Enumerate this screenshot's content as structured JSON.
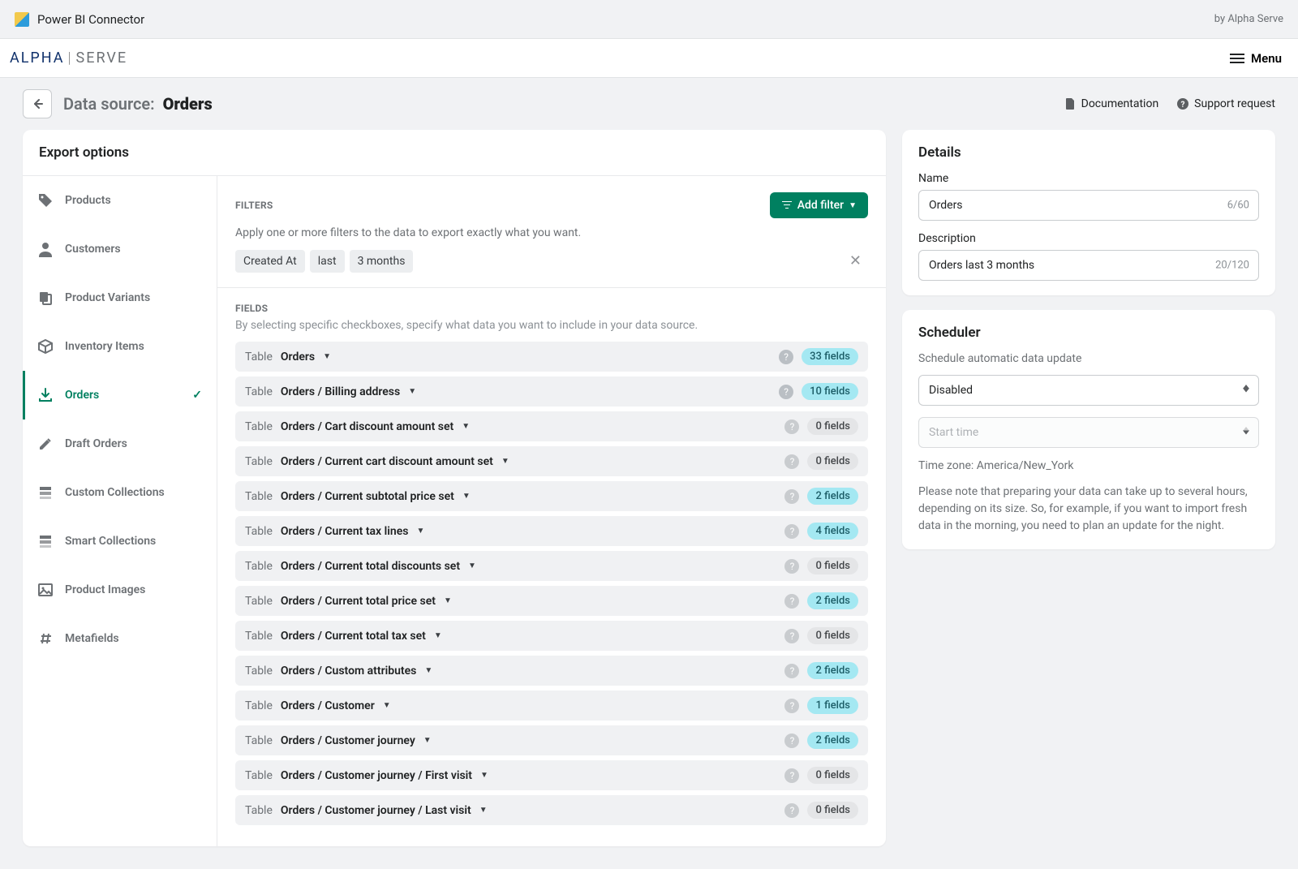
{
  "topbar": {
    "app_title": "Power BI Connector",
    "vendor": "by Alpha Serve"
  },
  "header": {
    "logo_a": "ALPHA",
    "logo_b": "SERVE",
    "menu": "Menu"
  },
  "subheader": {
    "label": "Data source:",
    "name": "Orders",
    "doc": "Documentation",
    "support": "Support request"
  },
  "export": {
    "title": "Export options",
    "nav": [
      {
        "id": "products",
        "label": "Products",
        "icon": "tag"
      },
      {
        "id": "customers",
        "label": "Customers",
        "icon": "user"
      },
      {
        "id": "variants",
        "label": "Product Variants",
        "icon": "copy"
      },
      {
        "id": "inventory",
        "label": "Inventory Items",
        "icon": "box"
      },
      {
        "id": "orders",
        "label": "Orders",
        "icon": "import",
        "active": true
      },
      {
        "id": "draft",
        "label": "Draft Orders",
        "icon": "edit"
      },
      {
        "id": "custom",
        "label": "Custom Collections",
        "icon": "stack"
      },
      {
        "id": "smart",
        "label": "Smart Collections",
        "icon": "stack"
      },
      {
        "id": "images",
        "label": "Product Images",
        "icon": "image"
      },
      {
        "id": "metafields",
        "label": "Metafields",
        "icon": "hash"
      }
    ],
    "filters": {
      "heading": "FILTERS",
      "add": "Add filter",
      "desc": "Apply one or more filters to the data to export exactly what you want.",
      "chips": [
        "Created At",
        "last",
        "3 months"
      ]
    },
    "fields": {
      "heading": "FIELDS",
      "desc": "By selecting specific checkboxes, specify what data you want to include in your data source.",
      "tables": [
        {
          "name": "Orders",
          "count": "33 fields",
          "on": true,
          "light": false
        },
        {
          "name": "Orders / Billing address",
          "count": "10 fields",
          "on": true,
          "light": false
        },
        {
          "name": "Orders / Cart discount amount set",
          "count": "0 fields",
          "on": false,
          "light": true
        },
        {
          "name": "Orders / Current cart discount amount set",
          "count": "0 fields",
          "on": false,
          "light": true
        },
        {
          "name": "Orders / Current subtotal price set",
          "count": "2 fields",
          "on": true,
          "light": true
        },
        {
          "name": "Orders / Current tax lines",
          "count": "4 fields",
          "on": true,
          "light": true
        },
        {
          "name": "Orders / Current total discounts set",
          "count": "0 fields",
          "on": false,
          "light": true
        },
        {
          "name": "Orders / Current total price set",
          "count": "2 fields",
          "on": true,
          "light": true
        },
        {
          "name": "Orders / Current total tax set",
          "count": "0 fields",
          "on": false,
          "light": true
        },
        {
          "name": "Orders / Custom attributes",
          "count": "2 fields",
          "on": true,
          "light": true
        },
        {
          "name": "Orders / Customer",
          "count": "1 fields",
          "on": true,
          "light": true
        },
        {
          "name": "Orders / Customer journey",
          "count": "2 fields",
          "on": true,
          "light": true
        },
        {
          "name": "Orders / Customer journey / First visit",
          "count": "0 fields",
          "on": false,
          "light": true
        },
        {
          "name": "Orders / Customer journey / Last visit",
          "count": "0 fields",
          "on": false,
          "light": true
        }
      ],
      "table_prefix": "Table"
    }
  },
  "details": {
    "title": "Details",
    "name_label": "Name",
    "name_value": "Orders",
    "name_counter": "6/60",
    "desc_label": "Description",
    "desc_value": "Orders last 3 months",
    "desc_counter": "20/120"
  },
  "scheduler": {
    "title": "Scheduler",
    "desc": "Schedule automatic data update",
    "interval": "Disabled",
    "start_placeholder": "Start time",
    "tz": "Time zone: America/New_York",
    "note": "Please note that preparing your data can take up to several hours, depending on its size. So, for example, if you want to import fresh data in the morning, you need to plan an update for the night."
  }
}
